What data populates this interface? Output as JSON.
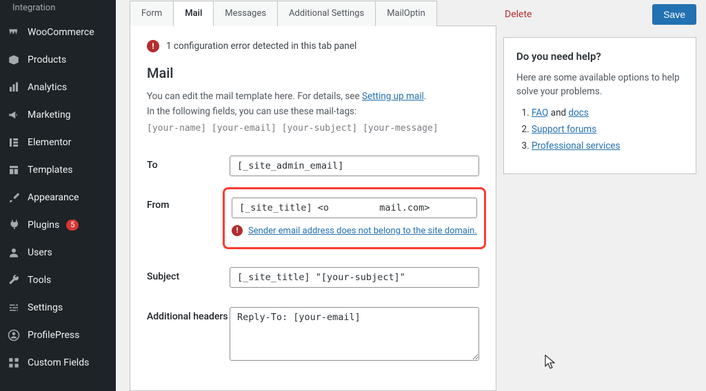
{
  "sidebar": {
    "top_label": "Integration",
    "items": [
      {
        "label": "WooCommerce",
        "icon": "woocommerce"
      },
      {
        "label": "Products",
        "icon": "box"
      },
      {
        "label": "Analytics",
        "icon": "chart"
      },
      {
        "label": "Marketing",
        "icon": "megaphone"
      },
      {
        "label": "Elementor",
        "icon": "elementor"
      },
      {
        "label": "Templates",
        "icon": "templates"
      },
      {
        "label": "Appearance",
        "icon": "brush"
      },
      {
        "label": "Plugins",
        "icon": "plug",
        "badge": "5"
      },
      {
        "label": "Users",
        "icon": "user"
      },
      {
        "label": "Tools",
        "icon": "wrench"
      },
      {
        "label": "Settings",
        "icon": "sliders"
      },
      {
        "label": "ProfilePress",
        "icon": "profile"
      },
      {
        "label": "Custom Fields",
        "icon": "grid"
      }
    ]
  },
  "tabs": [
    "Form",
    "Mail",
    "Messages",
    "Additional Settings",
    "MailOptin"
  ],
  "active_tab": "Mail",
  "config_error": "1 configuration error detected in this tab panel",
  "mail": {
    "heading": "Mail",
    "intro_line1": "You can edit the mail template here. For details, see ",
    "intro_link": "Setting up mail",
    "intro_line2": "In the following fields, you can use these mail-tags:",
    "mail_tags": "[your-name] [your-email] [your-subject] [your-message]",
    "labels": {
      "to": "To",
      "from": "From",
      "subject": "Subject",
      "additional_headers": "Additional headers"
    },
    "fields": {
      "to": "[_site_admin_email]",
      "from": "[_site_title] <o         mail.com>",
      "subject": "[_site_title] \"[your-subject]\"",
      "additional_headers": "Reply-To: [your-email]"
    },
    "from_error": "Sender email address does not belong to the site domain."
  },
  "actions": {
    "delete": "Delete",
    "save": "Save"
  },
  "help": {
    "title": "Do you need help?",
    "intro": "Here are some available options to help solve your problems.",
    "items": [
      {
        "prefix": "",
        "link": "FAQ",
        "mid": " and ",
        "link2": "docs",
        "suffix": ""
      },
      {
        "prefix": "",
        "link": "Support forums",
        "suffix": ""
      },
      {
        "prefix": "",
        "link": "Professional services",
        "suffix": ""
      }
    ]
  }
}
